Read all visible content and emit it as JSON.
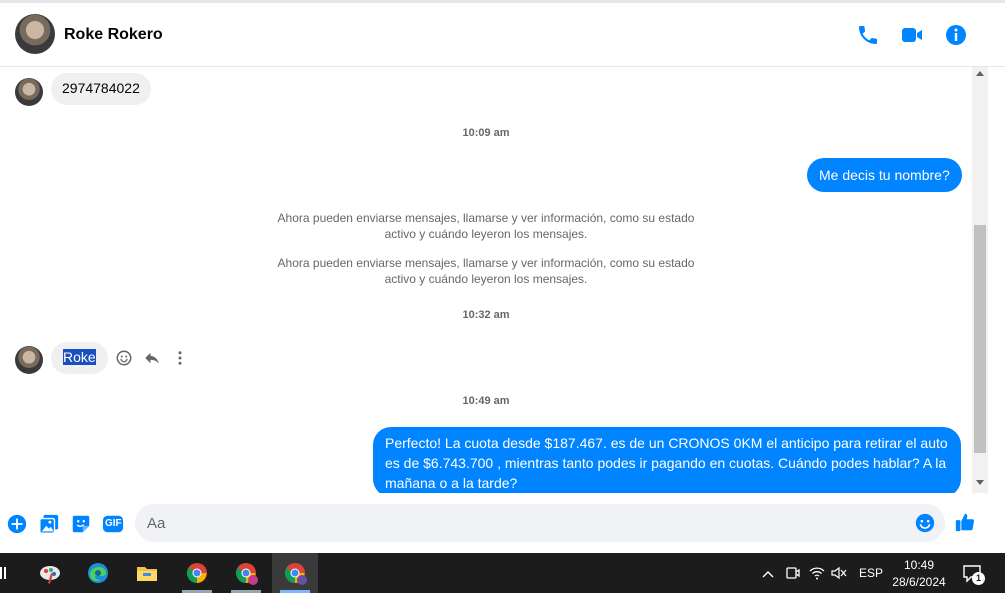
{
  "header": {
    "contact_name": "Roke Rokero",
    "icons": [
      "phone-icon",
      "video-icon",
      "info-icon"
    ],
    "accent_color": "#0084ff"
  },
  "messages": {
    "incoming_phone": "2974784022",
    "timestamp_1": "10:09 am",
    "outgoing_1": "Me decis tu nombre?",
    "system_1_line1": "Ahora pueden enviarse mensajes, llamarse y ver información, como su estado",
    "system_1_line2": "activo y cuándo leyeron los mensajes.",
    "system_2_line1": "Ahora pueden enviarse mensajes, llamarse y ver información, como su estado",
    "system_2_line2": "activo y cuándo leyeron los mensajes.",
    "timestamp_2": "10:32 am",
    "incoming_roke": "Roke",
    "timestamp_3": "10:49 am",
    "outgoing_2_line1": "Perfecto! La cuota desde $187.467. es de un CRONOS 0KM el anticipo para retirar el auto",
    "outgoing_2_line2": "es de $6.743.700 , mientras tanto podes ir pagando en cuotas. Cuándo podes hablar? A la",
    "outgoing_2_line3": "mañana o a la tarde?"
  },
  "composer": {
    "placeholder": "Aa",
    "gif_label": "GIF"
  },
  "taskbar": {
    "language": "ESP",
    "time": "10:49",
    "date": "28/6/2024",
    "notification_count": "1"
  }
}
